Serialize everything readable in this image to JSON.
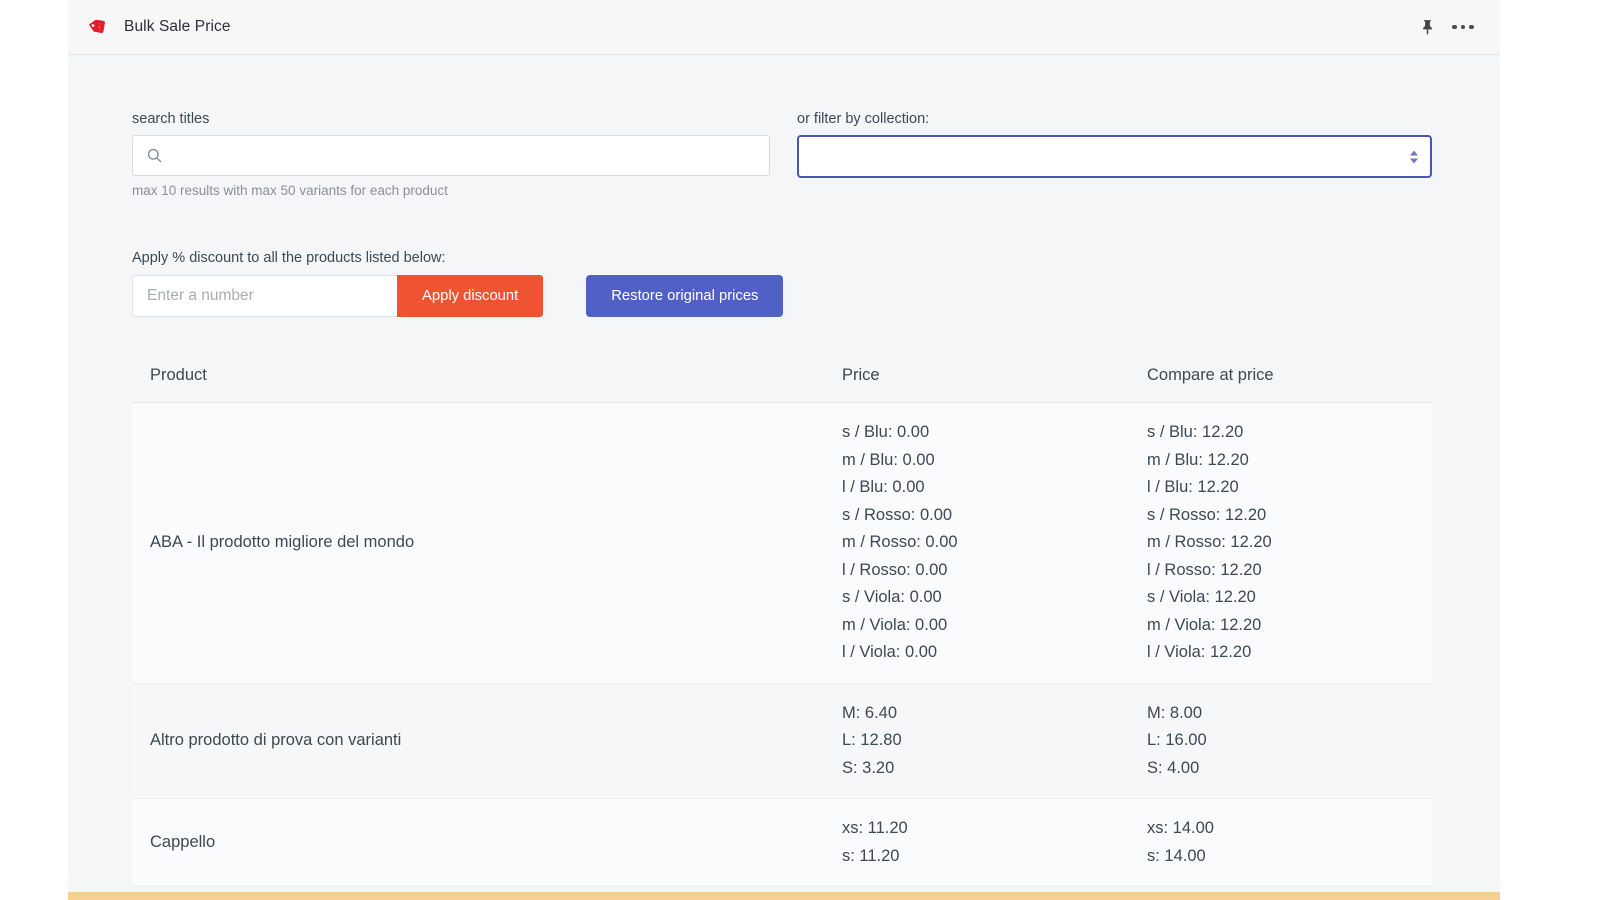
{
  "window": {
    "title": "Bulk Sale Price",
    "app_icon": "price-tag-icon",
    "pin_icon": "pin-icon",
    "more_icon": "more-options-icon",
    "accent_orange": "#ef5432",
    "accent_blue": "#5160c4",
    "focus_border": "#4a55b8",
    "bottom_bar_color": "#f6cf93"
  },
  "search": {
    "label": "search titles",
    "placeholder": "",
    "value": "",
    "icon": "search-icon",
    "helper": "max 10 results with max 50 variants for each product"
  },
  "collection_filter": {
    "label": "or filter by collection:",
    "selected": "",
    "options": [
      ""
    ],
    "icon": "chevron-updown-icon"
  },
  "discount": {
    "label": "Apply % discount to all the products listed below:",
    "input_placeholder": "Enter a number",
    "input_value": "",
    "apply_label": "Apply discount",
    "restore_label": "Restore original prices"
  },
  "table": {
    "headers": {
      "product": "Product",
      "price": "Price",
      "compare": "Compare at price"
    },
    "rows": [
      {
        "product": "ABA - Il prodotto migliore del mondo",
        "prices": [
          "s / Blu: 0.00",
          "m / Blu: 0.00",
          "l / Blu: 0.00",
          "s / Rosso: 0.00",
          "m / Rosso: 0.00",
          "l / Rosso: 0.00",
          "s / Viola: 0.00",
          "m / Viola: 0.00",
          "l / Viola: 0.00"
        ],
        "compare": [
          "s / Blu: 12.20",
          "m / Blu: 12.20",
          "l / Blu: 12.20",
          "s / Rosso: 12.20",
          "m / Rosso: 12.20",
          "l / Rosso: 12.20",
          "s / Viola: 12.20",
          "m / Viola: 12.20",
          "l / Viola: 12.20"
        ]
      },
      {
        "product": "Altro prodotto di prova con varianti",
        "prices": [
          "M: 6.40",
          "L: 12.80",
          "S: 3.20"
        ],
        "compare": [
          "M: 8.00",
          "L: 16.00",
          "S: 4.00"
        ]
      },
      {
        "product": "Cappello",
        "prices": [
          "xs: 11.20",
          "s: 11.20"
        ],
        "compare": [
          "xs: 14.00",
          "s: 14.00"
        ]
      }
    ]
  }
}
